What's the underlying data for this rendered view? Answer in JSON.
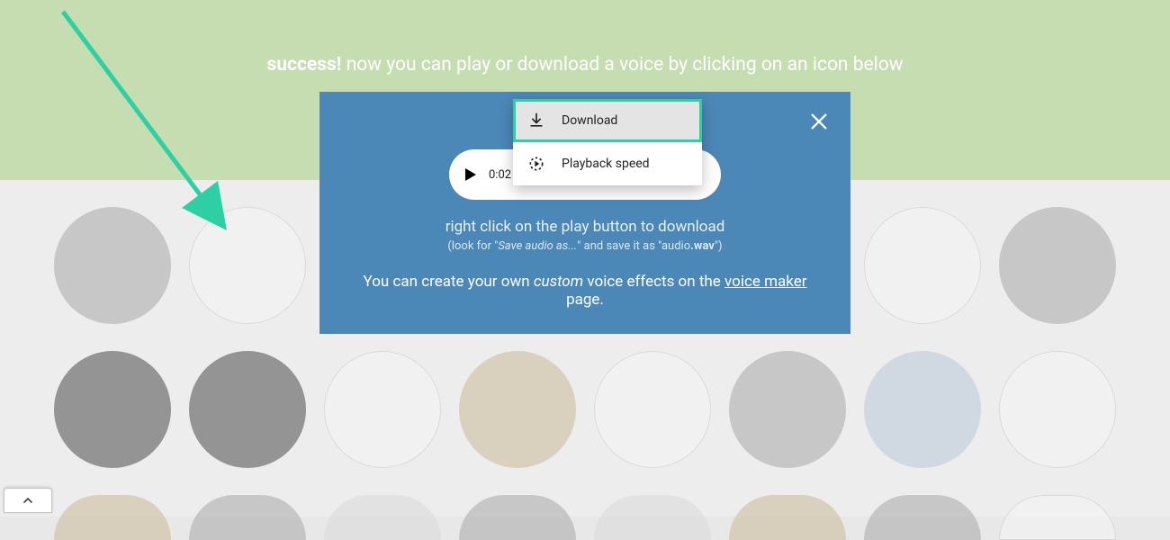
{
  "banner": {
    "success_label": "success!",
    "message": " now you can play or download a voice by clicking on an icon below"
  },
  "context_menu": {
    "download_label": "Download",
    "playback_label": "Playback speed"
  },
  "audio": {
    "time": "0:02"
  },
  "modal": {
    "tip_line1": "right click on the play button to download",
    "tip_line2_a": "(look for \"",
    "tip_line2_italic": "Save audio as...",
    "tip_line2_b": "\" and save it as \"audio",
    "tip_line2_ext": ".wav",
    "tip_line2_c": "\")",
    "tip_line3_a": "You can create your own ",
    "tip_line3_custom": "custom",
    "tip_line3_b": " voice effects on the ",
    "tip_line3_link": "voice maker",
    "tip_line3_c": " page."
  }
}
